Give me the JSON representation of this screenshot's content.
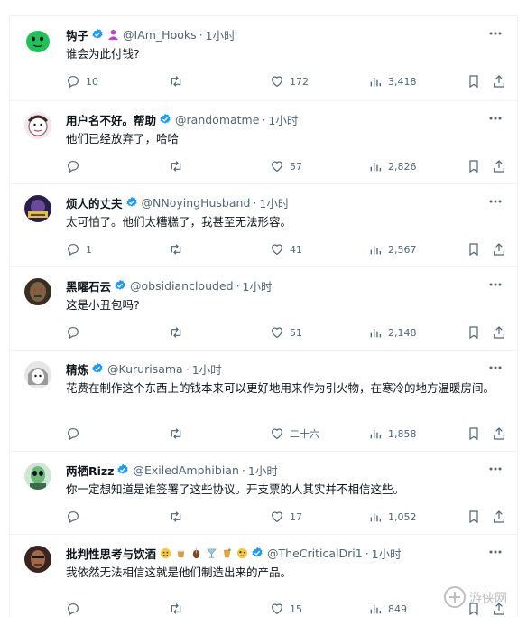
{
  "tweets": [
    {
      "name": "钩子",
      "handle": "@IAm_Hooks",
      "dot": "·",
      "time": "1小时",
      "text": "谁会为此付钱?",
      "actions": {
        "replies": "10",
        "retweets": "",
        "likes": "172",
        "views": "3,418"
      },
      "avatar_color": "#21c15a"
    },
    {
      "name": "用户名不好。帮助",
      "handle": "@randomatme",
      "dot": "·",
      "time": "1小时",
      "text": "他们已经放弃了，哈哈",
      "actions": {
        "replies": "",
        "retweets": "",
        "likes": "57",
        "views": "2,826"
      },
      "avatar_color": "#f2d3dc"
    },
    {
      "name": "烦人的丈夫",
      "handle": "@NNoyingHusband",
      "dot": "·",
      "time": "1小时",
      "text": "太可怕了。他们太糟糕了，我甚至无法形容。",
      "actions": {
        "replies": "1",
        "retweets": "",
        "likes": "41",
        "views": "2,567"
      },
      "avatar_color": "#3a2a6a"
    },
    {
      "name": "黑曜石云",
      "handle": "@obsidianclouded",
      "dot": "·",
      "time": "1小时",
      "text": "这是小丑包吗?",
      "actions": {
        "replies": "",
        "retweets": "",
        "likes": "51",
        "views": "2,148"
      },
      "avatar_color": "#4b3a2a"
    },
    {
      "name": "精炼",
      "handle": "@Kururisama",
      "dot": "·",
      "time": "1小时",
      "text": "花费在制作这个东西上的钱本来可以更好地用来作为引火物，在寒冷的地方温暖房间。",
      "actions": {
        "replies": "",
        "retweets": "",
        "likes": "二十六",
        "views": "1,858"
      },
      "avatar_color": "#cfcfcf"
    },
    {
      "name": "两栖Rizz",
      "handle": "@ExiledAmphibian",
      "dot": "·",
      "time": "1小时",
      "text": "你一定想知道是谁签署了这些协议。开支票的人其实并不相信这些。",
      "actions": {
        "replies": "",
        "retweets": "",
        "likes": "17",
        "views": "1,052"
      },
      "avatar_color": "#5aa06a"
    },
    {
      "name": "批判性思考与饮酒",
      "handle": "@TheCriticalDri1",
      "dot": "·",
      "time": "1小时",
      "text": "我依然无法相信这就是他们制造出来的产品。",
      "actions": {
        "replies": "",
        "retweets": "",
        "likes": "15",
        "views": "849"
      },
      "avatar_color": "#6a3a2a"
    }
  ],
  "colors": {
    "verified": "#1d9bf0",
    "secondary_text": "#536471",
    "border": "#eff3f4"
  },
  "watermark": "游侠网"
}
